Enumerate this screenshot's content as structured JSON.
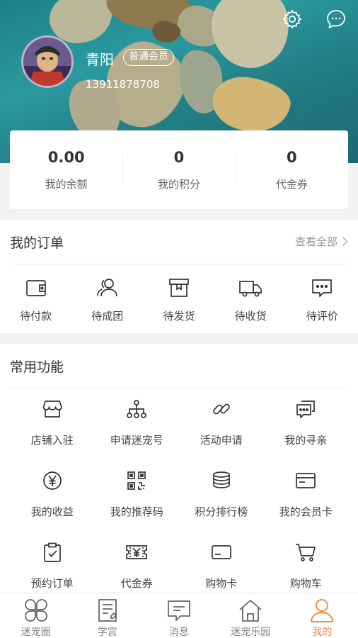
{
  "header": {
    "username": "青阳",
    "member_level": "普通会员",
    "phone": "13911878708",
    "settings_icon": "gear-icon",
    "message_icon": "chat-bubble-icon"
  },
  "stats": [
    {
      "value": "0.00",
      "label": "我的余额"
    },
    {
      "value": "0",
      "label": "我的积分"
    },
    {
      "value": "0",
      "label": "代金券"
    }
  ],
  "orders": {
    "title": "我的订单",
    "view_all": "查看全部",
    "items": [
      {
        "label": "待付款",
        "icon": "wallet-icon"
      },
      {
        "label": "待成团",
        "icon": "group-icon"
      },
      {
        "label": "待发货",
        "icon": "box-icon"
      },
      {
        "label": "待收货",
        "icon": "truck-icon"
      },
      {
        "label": "待评价",
        "icon": "comment-icon"
      }
    ]
  },
  "features": {
    "title": "常用功能",
    "items": [
      {
        "label": "店铺入驻",
        "icon": "store-icon"
      },
      {
        "label": "申请迷宠号",
        "icon": "hierarchy-icon"
      },
      {
        "label": "活动申请",
        "icon": "link-icon"
      },
      {
        "label": "我的寻亲",
        "icon": "chat-cards-icon"
      },
      {
        "label": "我的收益",
        "icon": "yen-icon"
      },
      {
        "label": "我的推荐码",
        "icon": "qrcode-icon"
      },
      {
        "label": "积分排行榜",
        "icon": "coin-stack-icon"
      },
      {
        "label": "我的会员卡",
        "icon": "member-card-icon"
      },
      {
        "label": "预约订单",
        "icon": "clipboard-check-icon"
      },
      {
        "label": "代金券",
        "icon": "voucher-icon"
      },
      {
        "label": "购物卡",
        "icon": "card-icon"
      },
      {
        "label": "购物车",
        "icon": "cart-icon"
      }
    ]
  },
  "tabbar": {
    "active_color": "#f08a44",
    "items": [
      {
        "label": "迷宠圈",
        "icon": "circles-icon"
      },
      {
        "label": "学宫",
        "icon": "notebook-icon"
      },
      {
        "label": "消息",
        "icon": "message-icon"
      },
      {
        "label": "迷宠乐园",
        "icon": "home-icon"
      },
      {
        "label": "我的",
        "icon": "person-icon"
      }
    ]
  }
}
